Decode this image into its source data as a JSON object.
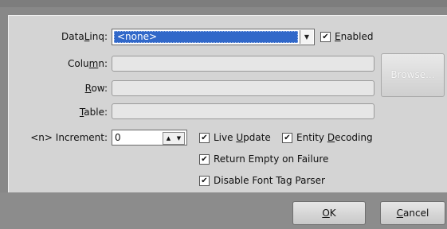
{
  "labels": {
    "dataling_pre": "Data",
    "dataling_key": "L",
    "dataling_post": "inq:",
    "column_pre": "Colu",
    "column_key": "m",
    "column_post": "n:",
    "row_key": "R",
    "row_post": "ow:",
    "table_key": "T",
    "table_post": "able:",
    "increment": "<n> Increment:"
  },
  "dataling_combo": {
    "selected": "<none>"
  },
  "enabled": {
    "key": "E",
    "rest": "nabled",
    "checked": true
  },
  "fields": {
    "column_value": "",
    "row_value": "",
    "table_value": ""
  },
  "browse_button": {
    "label": "Browse..."
  },
  "increment": {
    "value": "0"
  },
  "options": {
    "live_update": {
      "pre": "Live ",
      "key": "U",
      "post": "pdate",
      "checked": true
    },
    "entity_decoding": {
      "pre": "Entity ",
      "key": "D",
      "post": "ecoding",
      "checked": true
    },
    "return_empty": {
      "label": "Return Empty on Failure",
      "checked": true
    },
    "disable_font_tag": {
      "label": "Disable Font Tag Parser",
      "checked": true
    }
  },
  "buttons": {
    "ok_key": "O",
    "ok_post": "K",
    "cancel_key": "C",
    "cancel_post": "ancel"
  },
  "icons": {
    "check": "check-icon",
    "dropdown": "chevron-down-icon",
    "spin_up": "triangle-up-icon",
    "spin_down": "triangle-down-icon"
  }
}
